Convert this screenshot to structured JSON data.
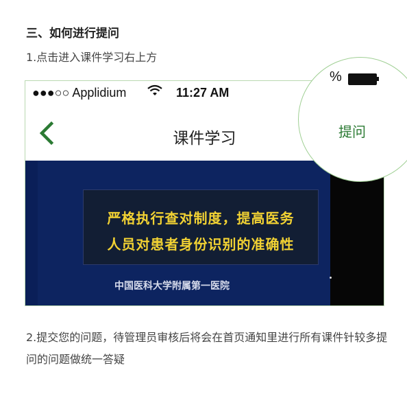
{
  "heading": "三、如何进行提问",
  "step1": "1.点击进入课件学习右上方",
  "phone": {
    "status": {
      "carrier": "●●●○○ Applidium",
      "wifi_icon": "wifi-icon",
      "time": "11:27 AM",
      "battery_pct": "%"
    },
    "nav": {
      "back_icon": "chevron-left-icon",
      "title": "课件学习",
      "action": "提问",
      "accent": "#2b7a33"
    },
    "video": {
      "slide_line1": "严格执行查对制度，提高医务",
      "slide_line2": "人员对患者身份识别的准确性",
      "hospital": "中国医科大学附属第一医院"
    }
  },
  "step2": "2.提交您的问题，待管理员审核后将会在首页通知里进行所有课件针较多提问的问题做统一答疑"
}
